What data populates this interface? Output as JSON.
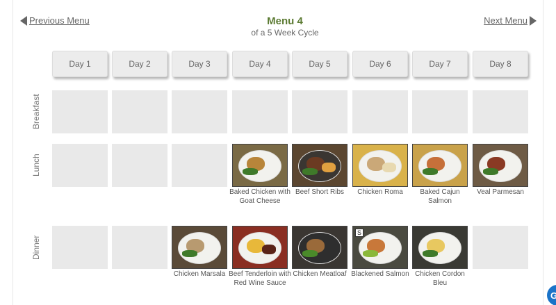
{
  "header": {
    "prev_label": "Previous Menu",
    "next_label": "Next Menu",
    "title": "Menu 4",
    "subtitle": "of a 5 Week Cycle"
  },
  "days": [
    "Day 1",
    "Day 2",
    "Day 3",
    "Day 4",
    "Day 5",
    "Day 6",
    "Day 7",
    "Day 8"
  ],
  "rows": {
    "breakfast": "Breakfast",
    "lunch": "Lunch",
    "dinner": "Dinner"
  },
  "lunch": [
    {
      "day": 4,
      "name": "Baked Chicken with Goat Cheese"
    },
    {
      "day": 5,
      "name": "Beef Short Ribs"
    },
    {
      "day": 6,
      "name": "Chicken Roma"
    },
    {
      "day": 7,
      "name": "Baked Cajun Salmon"
    },
    {
      "day": 8,
      "name": "Veal Parmesan"
    }
  ],
  "dinner": [
    {
      "day": 3,
      "name": "Chicken Marsala"
    },
    {
      "day": 4,
      "name": "Beef Tenderloin with Red Wine Sauce"
    },
    {
      "day": 5,
      "name": "Chicken Meatloaf"
    },
    {
      "day": 6,
      "name": "Blackened Salmon",
      "badge": "S"
    },
    {
      "day": 7,
      "name": "Chicken Cordon Bleu"
    }
  ],
  "chat": {
    "label": "G"
  },
  "colors": {
    "title_green": "#5b7a32",
    "empty_cell": "#e9e9e9",
    "chat_blue": "#1a73c8"
  }
}
